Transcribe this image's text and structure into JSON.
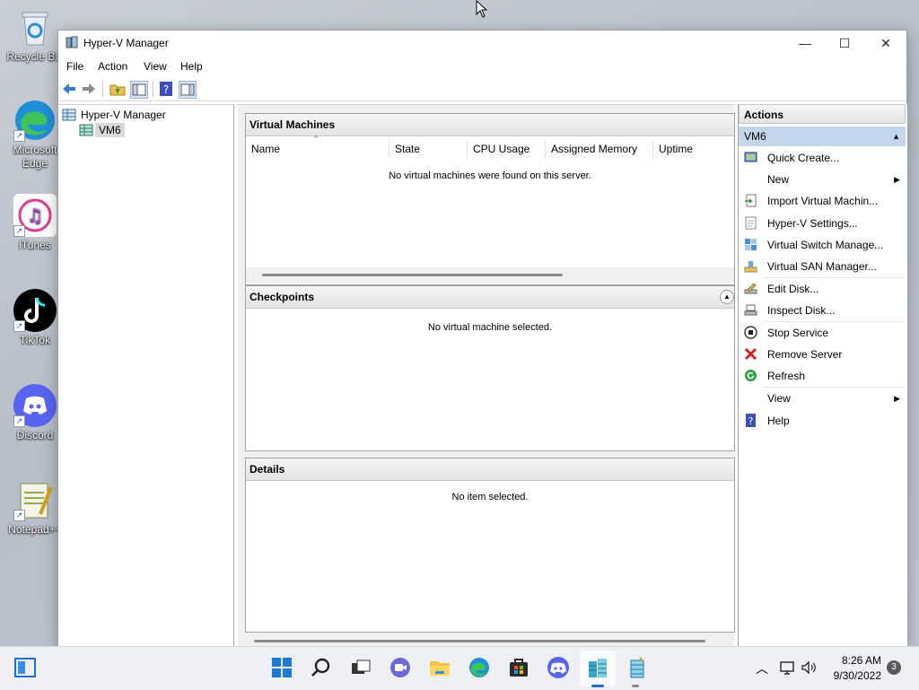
{
  "desktop": {
    "icons": [
      {
        "label": "Recycle Bin",
        "icon": "recycle-bin-icon"
      },
      {
        "label": "Microsoft Edge",
        "icon": "edge-icon"
      },
      {
        "label": "iTunes",
        "icon": "itunes-icon"
      },
      {
        "label": "TikTok",
        "icon": "tiktok-icon"
      },
      {
        "label": "Discord",
        "icon": "discord-icon"
      },
      {
        "label": "Notepad++",
        "icon": "notepadpp-icon"
      }
    ]
  },
  "window": {
    "title": "Hyper-V Manager",
    "controls": {
      "minimize": "—",
      "maximize": "☐",
      "close": "✕"
    }
  },
  "menu": [
    "File",
    "Action",
    "View",
    "Help"
  ],
  "tree": {
    "root": "Hyper-V Manager",
    "child": "VM6"
  },
  "virtual_machines": {
    "title": "Virtual Machines",
    "columns": [
      "Name",
      "State",
      "CPU Usage",
      "Assigned Memory",
      "Uptime"
    ],
    "empty_message": "No virtual machines were found on this server."
  },
  "checkpoints": {
    "title": "Checkpoints",
    "empty_message": "No virtual machine selected."
  },
  "details": {
    "title": "Details",
    "empty_message": "No item selected."
  },
  "actions": {
    "title": "Actions",
    "section": "VM6",
    "items": [
      {
        "label": "Quick Create...",
        "icon": "quick-create-icon"
      },
      {
        "label": "New",
        "icon": "",
        "submenu": true
      },
      {
        "label": "Import Virtual Machin...",
        "icon": "import-icon"
      },
      {
        "label": "Hyper-V Settings...",
        "icon": "settings-icon"
      },
      {
        "label": "Virtual Switch Manage...",
        "icon": "switch-icon"
      },
      {
        "label": "Virtual SAN Manager...",
        "icon": "san-icon"
      },
      {
        "label": "Edit Disk...",
        "icon": "edit-disk-icon"
      },
      {
        "label": "Inspect Disk...",
        "icon": "inspect-disk-icon"
      },
      {
        "label": "Stop Service",
        "icon": "stop-icon"
      },
      {
        "label": "Remove Server",
        "icon": "remove-icon"
      },
      {
        "label": "Refresh",
        "icon": "refresh-icon"
      },
      {
        "label": "View",
        "icon": "",
        "submenu": true
      },
      {
        "label": "Help",
        "icon": "help-icon"
      }
    ]
  },
  "taskbar": {
    "time": "8:26 AM",
    "date": "9/30/2022",
    "notification_count": "3"
  }
}
